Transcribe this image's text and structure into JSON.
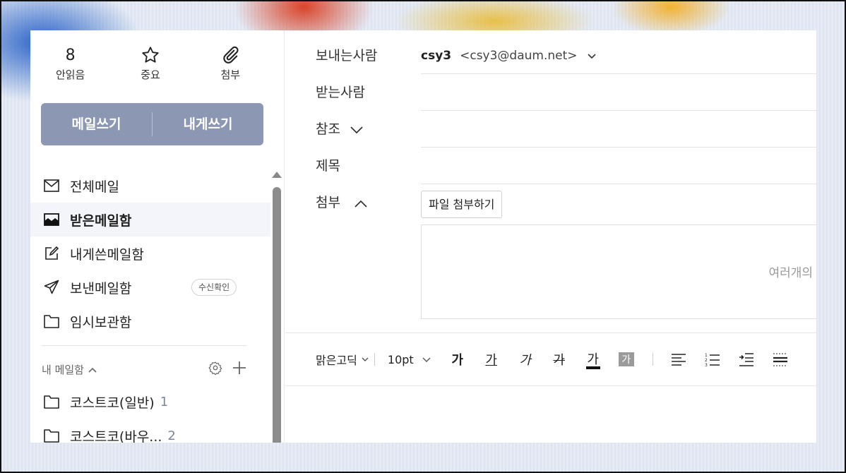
{
  "quick": {
    "unread_count": "8",
    "unread_label": "안읽음",
    "important_label": "중요",
    "attach_label": "첨부"
  },
  "compose": {
    "write_label": "메일쓰기",
    "self_label": "내게쓰기"
  },
  "folders": [
    {
      "label": "전체메일"
    },
    {
      "label": "받은메일함"
    },
    {
      "label": "내게쓴메일함"
    },
    {
      "label": "보낸메일함",
      "badge": "수신확인"
    },
    {
      "label": "임시보관함"
    }
  ],
  "mybox": {
    "header": "내 메일함",
    "items": [
      {
        "label": "코스트코(일반)",
        "count": "1"
      },
      {
        "label": "코스트코(바우...",
        "count": "2"
      }
    ]
  },
  "compose_form": {
    "sender_label": "보내는사람",
    "sender_name": "csy3",
    "sender_address": "<csy3@daum.net>",
    "to_label": "받는사람",
    "cc_label": "참조",
    "subject_label": "제목",
    "attach_label": "첨부",
    "attach_button": "파일 첨부하기",
    "drop_hint": "여러개의"
  },
  "toolbar": {
    "font": "맑은고딕",
    "size": "10pt",
    "bold": "가",
    "underline": "가",
    "italic": "가",
    "strike": "가",
    "color": "가",
    "bg": "가"
  }
}
